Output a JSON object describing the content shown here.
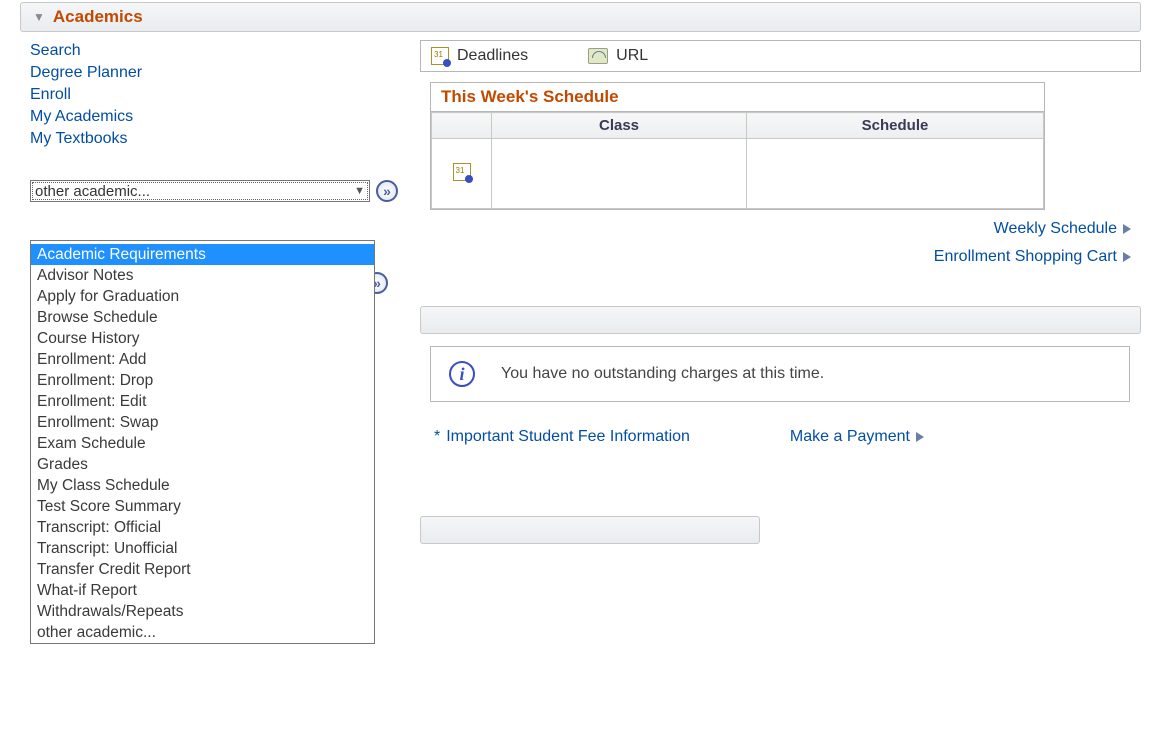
{
  "header": {
    "title": "Academics"
  },
  "links": [
    "Search",
    "Degree Planner",
    "Enroll",
    "My Academics",
    "My Textbooks"
  ],
  "dropdown": {
    "selected": "other academic...",
    "blank": "",
    "options": [
      "Academic Requirements",
      "Advisor Notes",
      "Apply for Graduation",
      "Browse Schedule",
      "Course History",
      "Enrollment: Add",
      "Enrollment: Drop",
      "Enrollment: Edit",
      "Enrollment: Swap",
      "Exam Schedule",
      "Grades",
      "My Class Schedule",
      "Test Score Summary",
      "Transcript: Official",
      "Transcript: Unofficial",
      "Transfer Credit Report",
      "What-if Report",
      "Withdrawals/Repeats",
      "other academic..."
    ],
    "highlighted_index": 0
  },
  "infobar": {
    "deadlines": "Deadlines",
    "url": "URL"
  },
  "schedule": {
    "title": "This Week's Schedule",
    "cols": [
      "Class",
      "Schedule"
    ]
  },
  "right_links": {
    "weekly": "Weekly Schedule",
    "cart": "Enrollment Shopping Cart"
  },
  "notice": "You have no outstanding charges at this time.",
  "fee_link": "Important Student Fee Information",
  "pay_link": "Make a Payment"
}
